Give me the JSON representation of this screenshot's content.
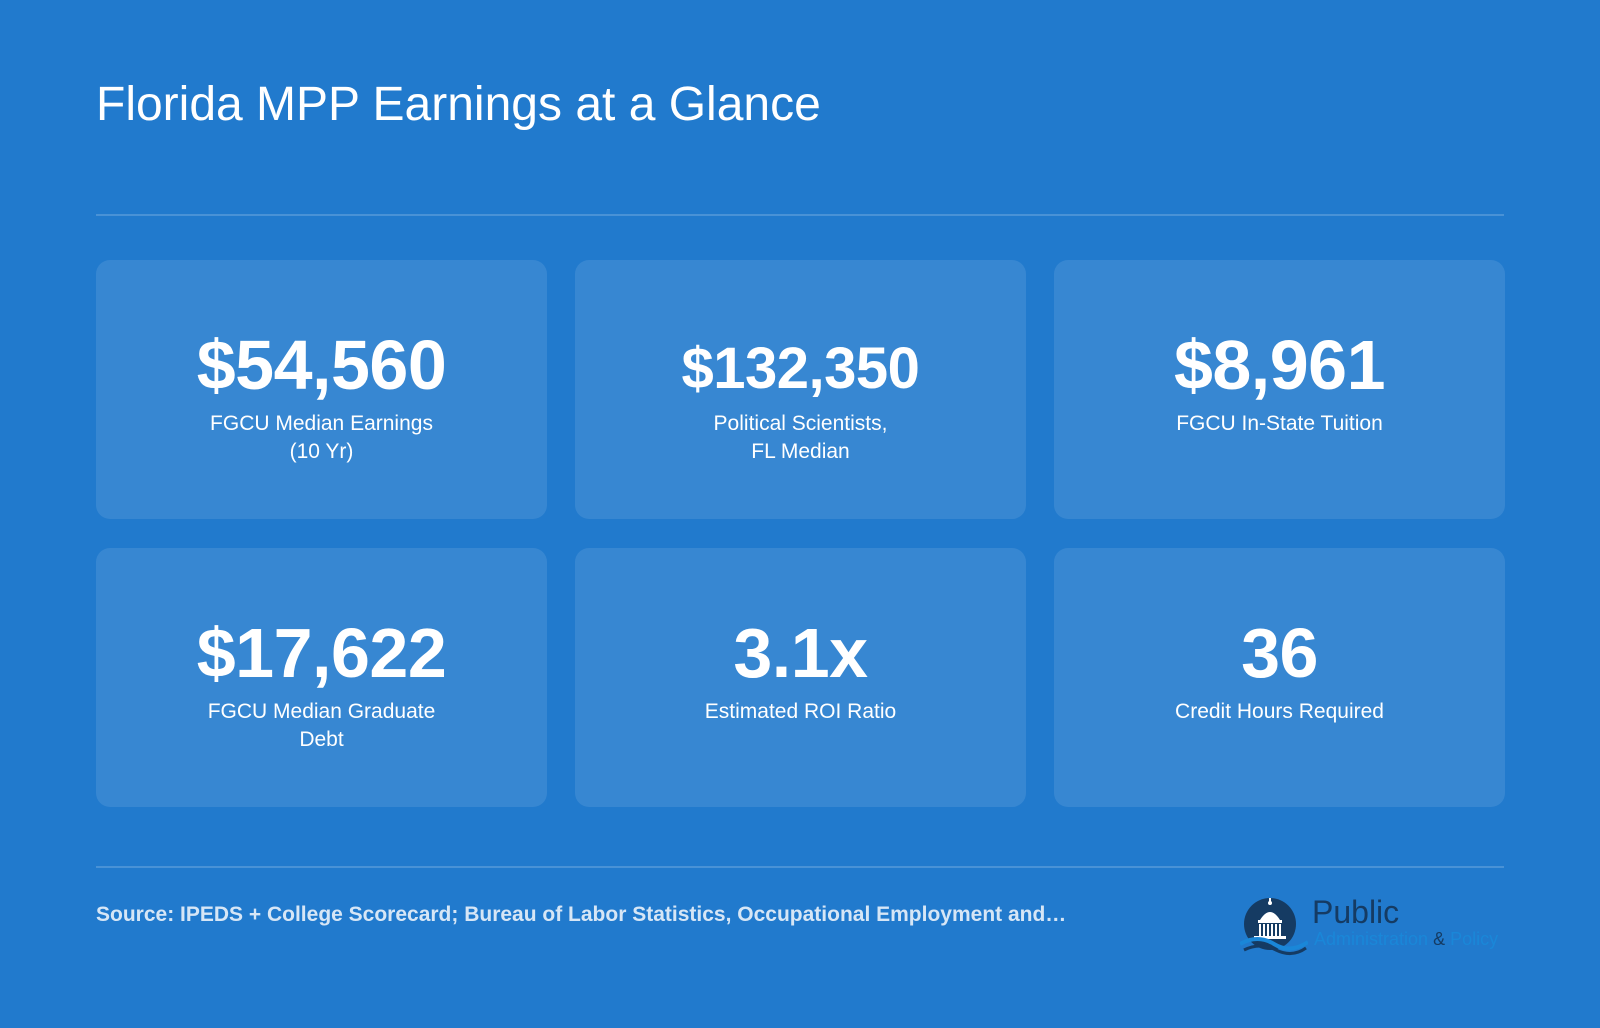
{
  "page": {
    "title": "Florida MPP Earnings at a Glance"
  },
  "cards": [
    {
      "value": "$54,560",
      "label_lines": [
        "FGCU Median Earnings",
        "(10 Yr)"
      ]
    },
    {
      "value": "$132,350",
      "label_lines": [
        "Political Scientists,",
        "FL Median"
      ]
    },
    {
      "value": "$8,961",
      "label_lines": [
        "FGCU In-State Tuition"
      ]
    },
    {
      "value": "$17,622",
      "label_lines": [
        "FGCU Median Graduate",
        "Debt"
      ]
    },
    {
      "value": "3.1x",
      "label_lines": [
        "Estimated ROI Ratio"
      ]
    },
    {
      "value": "36",
      "label_lines": [
        "Credit Hours Required"
      ]
    }
  ],
  "footer": {
    "source": "Source: IPEDS + College Scorecard; Bureau of Labor Statistics, Occupational Employment and…"
  },
  "logo": {
    "word": "Public",
    "tag_left": "Administration",
    "tag_amp": "&",
    "tag_right": "Policy",
    "icon": "capitol-dome-icon"
  },
  "colors": {
    "background": "#217ACD",
    "card": "rgba(255,255,255,0.10)",
    "text": "#ffffff",
    "logo_dark": "#153b63"
  }
}
